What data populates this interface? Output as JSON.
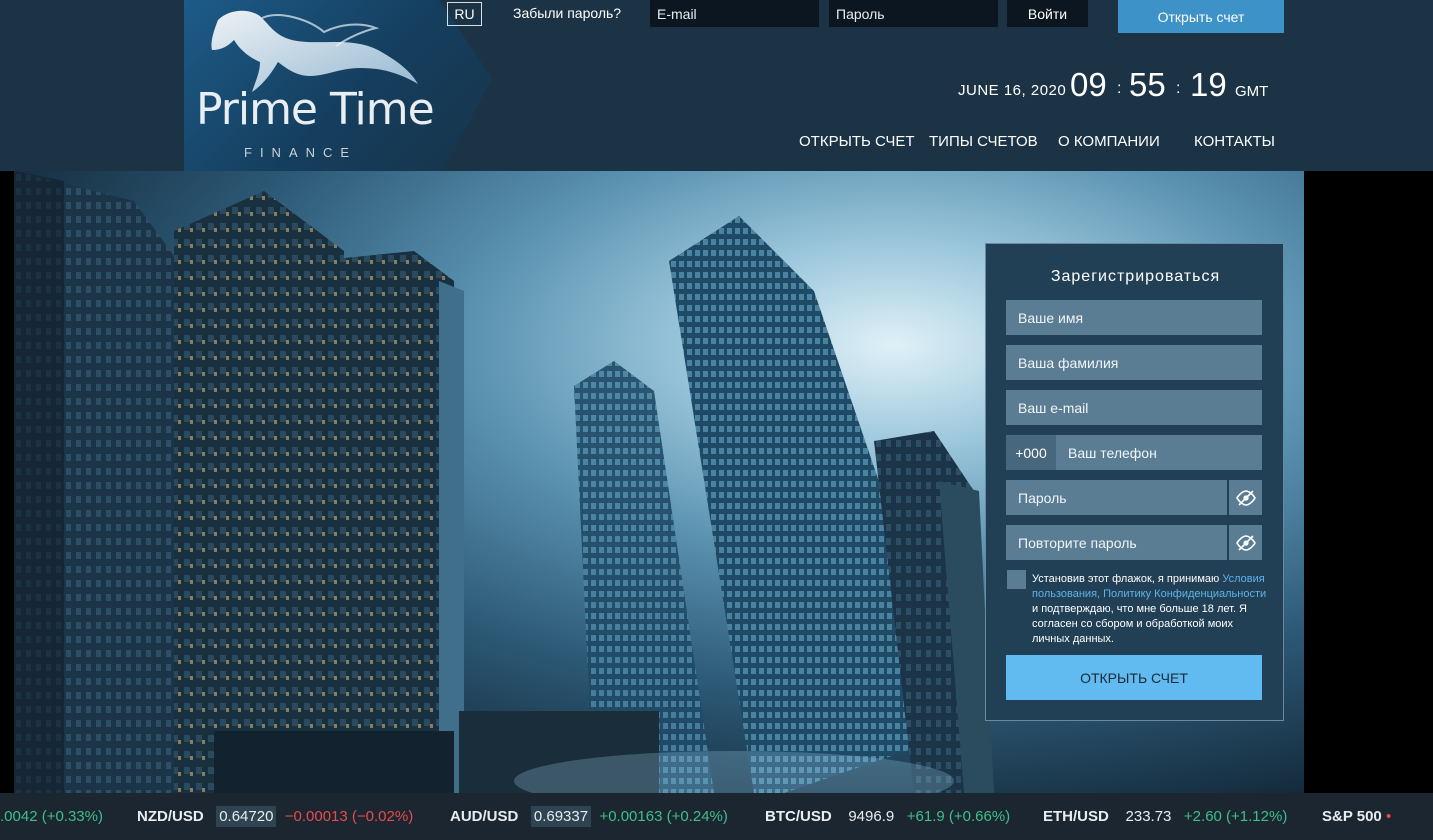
{
  "header": {
    "logo": {
      "name": "Prime Time",
      "sub": "FINANCE"
    },
    "lang": "RU",
    "forgot_password": "Забыли пароль?",
    "email_placeholder": "E-mail",
    "password_placeholder": "Пароль",
    "login_label": "Войти",
    "open_account_label": "Открыть счет",
    "date": "JUNE 16, 2020",
    "clock": {
      "hours": "09",
      "minutes": "55",
      "seconds": "19",
      "sep": ":",
      "tz": "GMT"
    },
    "nav": [
      "ОТКРЫТЬ СЧЕТ",
      "ТИПЫ СЧЕТОВ",
      "О КОМПАНИИ",
      "КОНТАКТЫ"
    ]
  },
  "register": {
    "title": "Зарегистрироваться",
    "first_name": "Ваше имя",
    "last_name": "Ваша фамилия",
    "email": "Ваш e-mail",
    "phone_prefix": "+000",
    "phone": "Ваш телефон",
    "password": "Пароль",
    "password_repeat": "Повторите пароль",
    "terms_before": "Установив этот флажок, я принимаю ",
    "terms_link": "Условия пользования, Политику Конфиденциальности",
    "terms_after": " и подтверждаю, что мне больше 18 лет. Я согласен со сбором и обработкой моих личных данных.",
    "submit": "ОТКРЫТЬ СЧЕТ"
  },
  "ticker": [
    {
      "sym": "",
      "price": "",
      "change": ".0042 (+0.33%)",
      "dir": "up"
    },
    {
      "sym": "NZD/USD",
      "price": "0.64720",
      "change": "−0.00013 (−0.02%)",
      "dir": "down"
    },
    {
      "sym": "AUD/USD",
      "price": "0.69337",
      "change": "+0.00163 (+0.24%)",
      "dir": "up"
    },
    {
      "sym": "BTC/USD",
      "price": "9496.9",
      "change": "+61.9 (+0.66%)",
      "dir": "up"
    },
    {
      "sym": "ETH/USD",
      "price": "233.73",
      "change": "+2.60 (+1.12%)",
      "dir": "up"
    },
    {
      "sym": "S&P 500",
      "price": "",
      "change": "•",
      "dir": "down"
    }
  ],
  "colors": {
    "header_bg": "#1b3345",
    "accent_button": "#3d92c7",
    "submit_button": "#61baf0",
    "form_bg": "#214055",
    "field_bg": "#5a7d93",
    "ticker_up": "#3fbf8a",
    "ticker_down": "#e84b4b"
  }
}
